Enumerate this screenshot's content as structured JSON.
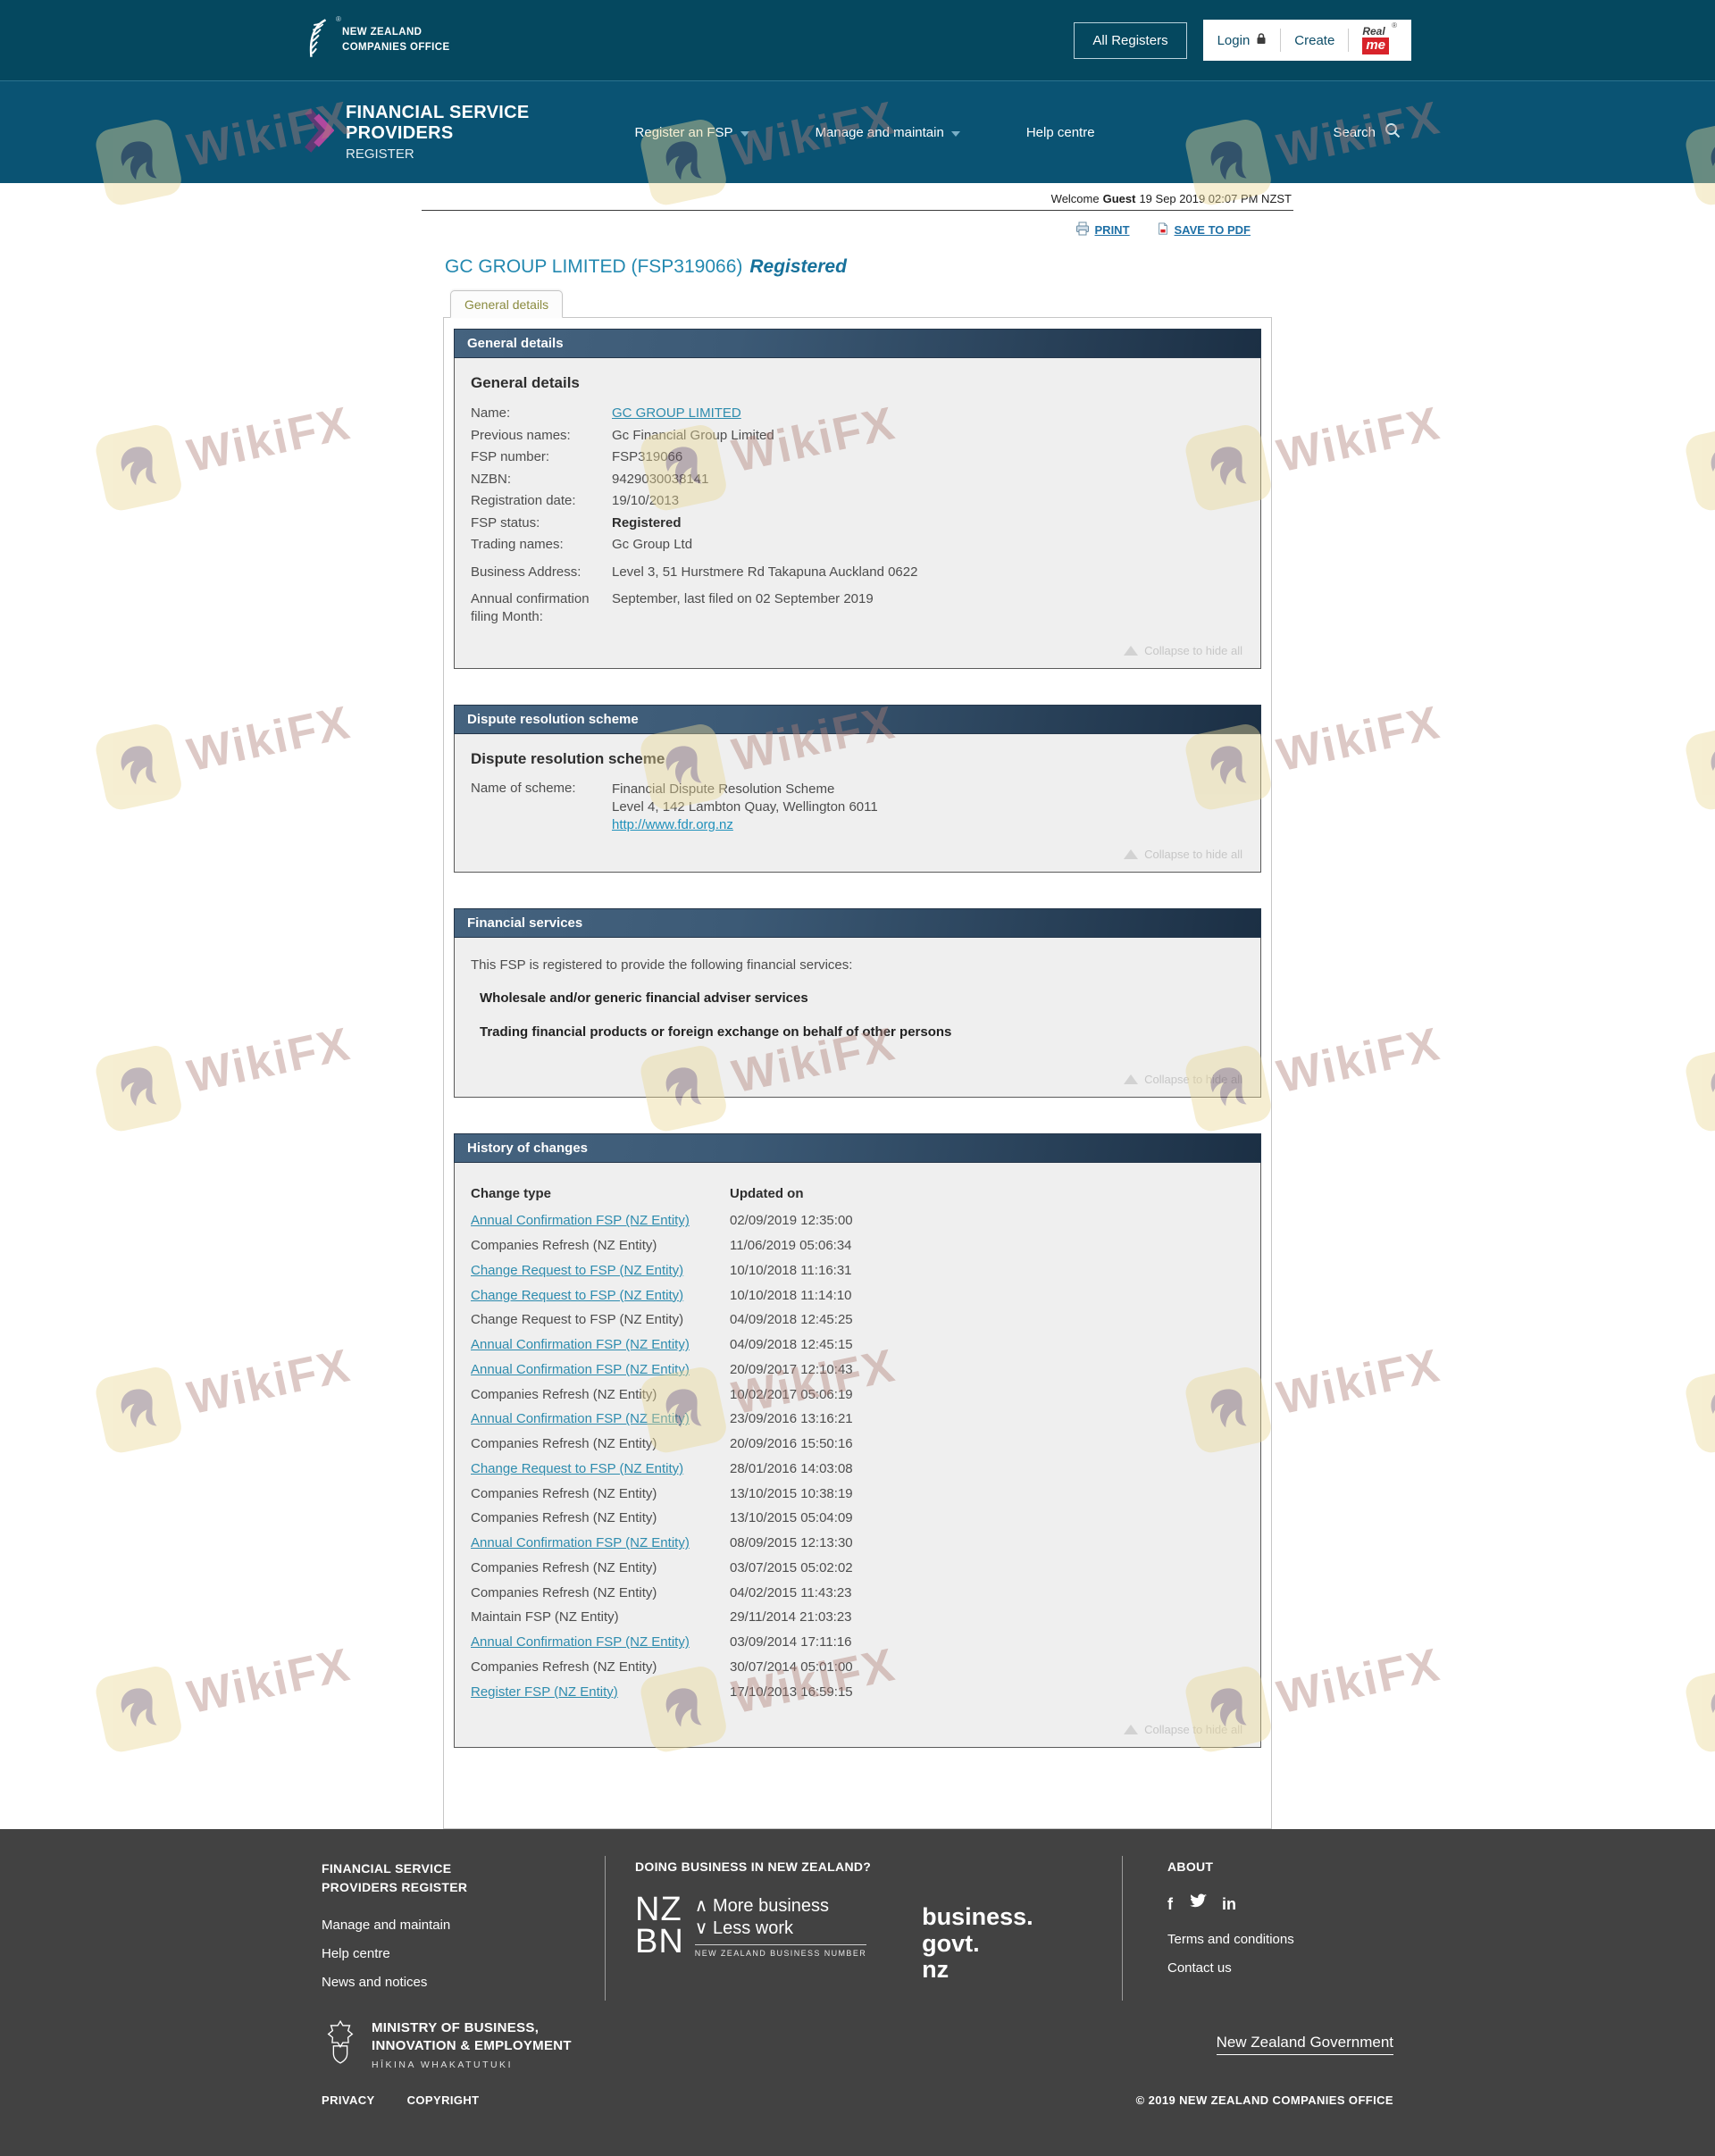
{
  "watermark": {
    "text": "WikiFX"
  },
  "colors": {
    "header_teal": "#05485f",
    "nav_teal": "#0a5373",
    "link_blue": "#2e8cae",
    "title_blue": "#2489b0",
    "tab_olive": "#8a8b3f",
    "panel_bg": "#efefef",
    "footer_gray": "#424242",
    "realme_red": "#d8232a"
  },
  "top_header": {
    "logo_line1": "NEW ZEALAND",
    "logo_line2": "COMPANIES OFFICE",
    "logo_reg": "®",
    "all_registers_label": "All Registers",
    "login_label": "Login",
    "create_label": "Create",
    "realme": {
      "real": "Real",
      "me": "me",
      "reg": "®"
    }
  },
  "nav": {
    "brand_line1": "FINANCIAL SERVICE",
    "brand_line2": "PROVIDERS",
    "brand_line3": "REGISTER",
    "items": [
      {
        "label": "Register an FSP",
        "has_dropdown": true
      },
      {
        "label": "Manage and maintain",
        "has_dropdown": true
      },
      {
        "label": "Help centre"
      }
    ],
    "search_label": "Search"
  },
  "statusbar": {
    "prefix": "Welcome",
    "user": "Guest",
    "datetime": "19 Sep 2019 02:07 PM NZST"
  },
  "actions": {
    "print": "PRINT",
    "save_pdf": "SAVE TO PDF"
  },
  "page": {
    "title": "GC GROUP LIMITED (FSP319066)",
    "status": "Registered"
  },
  "tab_label": "General details",
  "general": {
    "header": "General details",
    "heading": "General details",
    "rows": [
      {
        "label": "Name:",
        "value": "GC GROUP LIMITED",
        "link": true
      },
      {
        "label": "Previous names:",
        "value": "Gc Financial Group Limited"
      },
      {
        "label": "FSP number:",
        "value": "FSP319066"
      },
      {
        "label": "NZBN:",
        "value": "9429030038141"
      },
      {
        "label": "Registration date:",
        "value": "19/10/2013"
      },
      {
        "label": "FSP status:",
        "value": "Registered",
        "bold": true
      },
      {
        "label": "Trading names:",
        "value": "Gc Group Ltd"
      },
      {
        "label": "Business Address:",
        "value": "Level 3, 51 Hurstmere Rd Takapuna Auckland 0622"
      },
      {
        "label": "Annual confirmation filing Month:",
        "value": "September, last filed on 02 September 2019"
      }
    ],
    "collapse": "Collapse to hide all"
  },
  "dispute": {
    "header": "Dispute resolution scheme",
    "heading": "Dispute resolution scheme",
    "label": "Name of scheme:",
    "line1": "Financial Dispute Resolution Scheme",
    "line2": "Level 4, 142 Lambton Quay, Wellington 6011",
    "link": "http://www.fdr.org.nz",
    "collapse": "Collapse to hide all"
  },
  "financial": {
    "header": "Financial services",
    "intro": "This FSP is registered to provide the following financial services:",
    "items": [
      "Wholesale and/or generic financial adviser services",
      "Trading financial products or foreign exchange on behalf of other persons"
    ],
    "collapse": "Collapse to hide all"
  },
  "history": {
    "header": "History of changes",
    "col1": "Change type",
    "col2": "Updated on",
    "rows": [
      {
        "type": "Annual Confirmation FSP (NZ Entity)",
        "link": true,
        "updated": "02/09/2019 12:35:00"
      },
      {
        "type": "Companies Refresh (NZ Entity)",
        "link": false,
        "updated": "11/06/2019 05:06:34"
      },
      {
        "type": "Change Request to FSP (NZ Entity)",
        "link": true,
        "updated": "10/10/2018 11:16:31"
      },
      {
        "type": "Change Request to FSP (NZ Entity)",
        "link": true,
        "updated": "10/10/2018 11:14:10"
      },
      {
        "type": "Change Request to FSP (NZ Entity)",
        "link": false,
        "updated": "04/09/2018 12:45:25"
      },
      {
        "type": "Annual Confirmation FSP (NZ Entity)",
        "link": true,
        "updated": "04/09/2018 12:45:15"
      },
      {
        "type": "Annual Confirmation FSP (NZ Entity)",
        "link": true,
        "updated": "20/09/2017 12:10:43"
      },
      {
        "type": "Companies Refresh (NZ Entity)",
        "link": false,
        "updated": "10/02/2017 05:06:19"
      },
      {
        "type": "Annual Confirmation FSP (NZ Entity)",
        "link": true,
        "updated": "23/09/2016 13:16:21"
      },
      {
        "type": "Companies Refresh (NZ Entity)",
        "link": false,
        "updated": "20/09/2016 15:50:16"
      },
      {
        "type": "Change Request to FSP (NZ Entity)",
        "link": true,
        "updated": "28/01/2016 14:03:08"
      },
      {
        "type": "Companies Refresh (NZ Entity)",
        "link": false,
        "updated": "13/10/2015 10:38:19"
      },
      {
        "type": "Companies Refresh (NZ Entity)",
        "link": false,
        "updated": "13/10/2015 05:04:09"
      },
      {
        "type": "Annual Confirmation FSP (NZ Entity)",
        "link": true,
        "updated": "08/09/2015 12:13:30"
      },
      {
        "type": "Companies Refresh (NZ Entity)",
        "link": false,
        "updated": "03/07/2015 05:02:02"
      },
      {
        "type": "Companies Refresh (NZ Entity)",
        "link": false,
        "updated": "04/02/2015 11:43:23"
      },
      {
        "type": "Maintain FSP (NZ Entity)",
        "link": false,
        "updated": "29/11/2014 21:03:23"
      },
      {
        "type": "Annual Confirmation FSP (NZ Entity)",
        "link": true,
        "updated": "03/09/2014 17:11:16"
      },
      {
        "type": "Companies Refresh (NZ Entity)",
        "link": false,
        "updated": "30/07/2014 05:01:00"
      },
      {
        "type": "Register FSP (NZ Entity)",
        "link": true,
        "updated": "17/10/2013 16:59:15"
      }
    ],
    "collapse": "Collapse to hide all"
  },
  "footer": {
    "fsp_heading": "FINANCIAL SERVICE PROVIDERS REGISTER",
    "fsp_links": [
      "Manage and maintain",
      "Help centre",
      "News and notices"
    ],
    "doing_business_heading": "DOING BUSINESS IN NEW ZEALAND?",
    "nzbn": {
      "nz": "NZ",
      "bn": "BN",
      "more": "∧ More business",
      "less": "∨ Less work",
      "tagline": "NEW ZEALAND BUSINESS NUMBER"
    },
    "bgn_line1": "business.",
    "bgn_line2": "govt.",
    "bgn_line3": "nz",
    "about_heading": "ABOUT",
    "facebook_glyph": "f",
    "linkedin_glyph": "in",
    "about_links": [
      "Terms and conditions",
      "Contact us"
    ],
    "mbie_line1": "MINISTRY OF BUSINESS,",
    "mbie_line2": "INNOVATION & EMPLOYMENT",
    "mbie_line3": "HĪKINA WHAKATUTUKI",
    "nz_govt": "New Zealand Government",
    "bottom_links": [
      "PRIVACY",
      "COPYRIGHT"
    ],
    "copyright": "© 2019 NEW ZEALAND COMPANIES OFFICE"
  }
}
